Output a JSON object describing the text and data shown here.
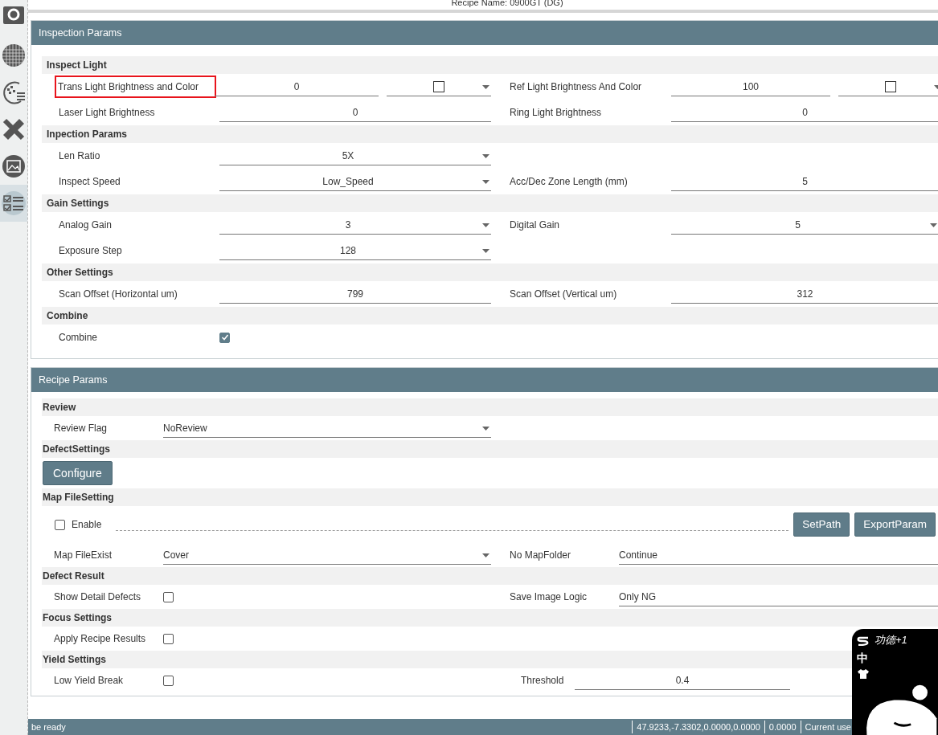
{
  "header": {
    "recipe_name": "Recipe Name: 0900GT (DG)"
  },
  "sidebar": {
    "items": [
      {
        "kind": "ring",
        "selected": false
      },
      {
        "kind": "grid",
        "selected": false
      },
      {
        "kind": "scatter",
        "selected": false
      },
      {
        "kind": "ruler",
        "selected": false
      },
      {
        "kind": "image",
        "selected": false
      },
      {
        "kind": "checklist",
        "selected": true
      }
    ]
  },
  "panels": [
    {
      "title": "Inspection Params",
      "sections": [
        {
          "title": "Inspect Light",
          "rows": [
            {
              "kind": "pair",
              "left": {
                "label": "Trans Light Brightness and Color",
                "highlighted": true,
                "kind": "input_color",
                "value": "0",
                "checked": false
              },
              "right": {
                "label": "Ref Light Brightness And Color",
                "highlighted": false,
                "kind": "input_color",
                "value": "100",
                "checked": false
              }
            },
            {
              "kind": "pair",
              "left": {
                "label": "Laser Light Brightness",
                "highlighted": false,
                "kind": "input",
                "value": "0"
              },
              "right": {
                "label": "Ring Light Brightness",
                "highlighted": false,
                "kind": "input",
                "value": "0"
              }
            }
          ]
        },
        {
          "title": "Inpection Params",
          "rows": [
            {
              "kind": "pair",
              "left": {
                "label": "Len Ratio",
                "highlighted": false,
                "kind": "select",
                "value": "5X"
              }
            },
            {
              "kind": "pair",
              "left": {
                "label": "Inspect Speed",
                "highlighted": false,
                "kind": "select",
                "value": "Low_Speed"
              },
              "right": {
                "label": "Acc/Dec Zone Length (mm)",
                "highlighted": false,
                "kind": "input",
                "value": "5"
              }
            }
          ]
        },
        {
          "title": "Gain Settings",
          "rows": [
            {
              "kind": "pair",
              "left": {
                "label": "Analog Gain",
                "highlighted": false,
                "kind": "select",
                "value": "3"
              },
              "right": {
                "label": "Digital Gain",
                "highlighted": false,
                "kind": "select",
                "value": "5"
              }
            },
            {
              "kind": "pair",
              "left": {
                "label": "Exposure Step",
                "highlighted": false,
                "kind": "select",
                "value": "128"
              }
            }
          ]
        },
        {
          "title": "Other Settings",
          "rows": [
            {
              "kind": "pair",
              "left": {
                "label": "Scan Offset (Horizontal um)",
                "highlighted": false,
                "kind": "input",
                "value": "799"
              },
              "right": {
                "label": "Scan Offset (Vertical um)",
                "highlighted": false,
                "kind": "input",
                "value": "312"
              }
            }
          ]
        },
        {
          "title": "Combine",
          "rows": [
            {
              "kind": "pair",
              "left": {
                "label": "Combine",
                "highlighted": false,
                "kind": "checkbox",
                "checked": true
              }
            }
          ]
        }
      ]
    },
    {
      "title": "Recipe Params",
      "sections": [
        {
          "title": "Review",
          "rows": [
            {
              "kind": "pair",
              "left": {
                "label": "Review Flag",
                "highlighted": false,
                "kind": "select",
                "value": "NoReview"
              }
            }
          ]
        },
        {
          "title": "DefectSettings",
          "rows": [
            {
              "kind": "button",
              "label": "Configure"
            }
          ]
        },
        {
          "title": "Map FileSetting",
          "rows": [
            {
              "kind": "enable",
              "label": "Enable",
              "checked": false,
              "buttons": [
                "SetPath",
                "ExportParam"
              ]
            },
            {
              "kind": "pair",
              "left": {
                "label": "Map FileExist",
                "highlighted": false,
                "kind": "select",
                "value": "Cover"
              },
              "right": {
                "label": "No MapFolder",
                "highlighted": false,
                "kind": "input",
                "value": "Continue"
              }
            }
          ]
        },
        {
          "title": "Defect Result",
          "rows": [
            {
              "kind": "pair",
              "left": {
                "label": "Show Detail Defects",
                "highlighted": false,
                "kind": "checkbox",
                "checked": false
              },
              "right": {
                "label": "Save Image Logic",
                "highlighted": false,
                "kind": "input",
                "value": "Only NG"
              }
            }
          ]
        },
        {
          "title": "Focus Settings",
          "rows": [
            {
              "kind": "pair",
              "left": {
                "label": "Apply Recipe Results",
                "highlighted": false,
                "kind": "checkbox",
                "checked": false
              }
            }
          ]
        },
        {
          "title": "Yield Settings",
          "rows": [
            {
              "kind": "pair",
              "left": {
                "label": "Low Yield Break",
                "highlighted": false,
                "kind": "checkbox",
                "checked": false
              },
              "right": {
                "label": "Threshold",
                "highlighted": false,
                "kind": "threshold",
                "value": "0.4"
              }
            }
          ]
        }
      ]
    }
  ],
  "status_bar": {
    "message": "be ready",
    "segments": [
      "47.9233,-7.3302,0.0000,0.0000",
      "0.0000",
      "Current use"
    ]
  },
  "ime_widget": {
    "mode": "中",
    "caption": "功德+1"
  }
}
